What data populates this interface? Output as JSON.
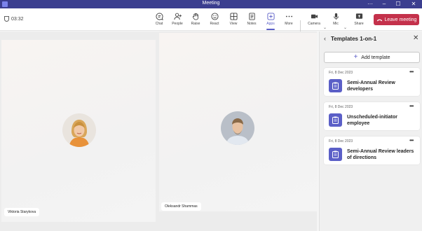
{
  "window": {
    "title": "Meeting"
  },
  "toolbar": {
    "timer": "03:32",
    "buttons": [
      {
        "label": "Chat"
      },
      {
        "label": "People"
      },
      {
        "label": "Raise"
      },
      {
        "label": "React"
      },
      {
        "label": "View"
      },
      {
        "label": "Notes"
      },
      {
        "label": "Apps"
      },
      {
        "label": "More"
      },
      {
        "label": "Camera"
      },
      {
        "label": "Mic"
      },
      {
        "label": "Share"
      }
    ],
    "leave_label": "Leave meeting",
    "accent_color": "#5b5fc7",
    "leave_color": "#c4314b"
  },
  "participants": [
    {
      "name": "Viktoria Starykova"
    },
    {
      "name": "Oleksandr Shammas"
    }
  ],
  "panel": {
    "title": "Templates 1-on-1",
    "add_label": "Add template",
    "cards": [
      {
        "date": "Fri, 8 Dec 2023",
        "title": "Semi-Annual Review developers"
      },
      {
        "date": "Fri, 8 Dec 2023",
        "title": "Unscheduled-initiator employee"
      },
      {
        "date": "Fri, 8 Dec 2023",
        "title": "Semi-Annual Review leaders of directions"
      }
    ]
  }
}
